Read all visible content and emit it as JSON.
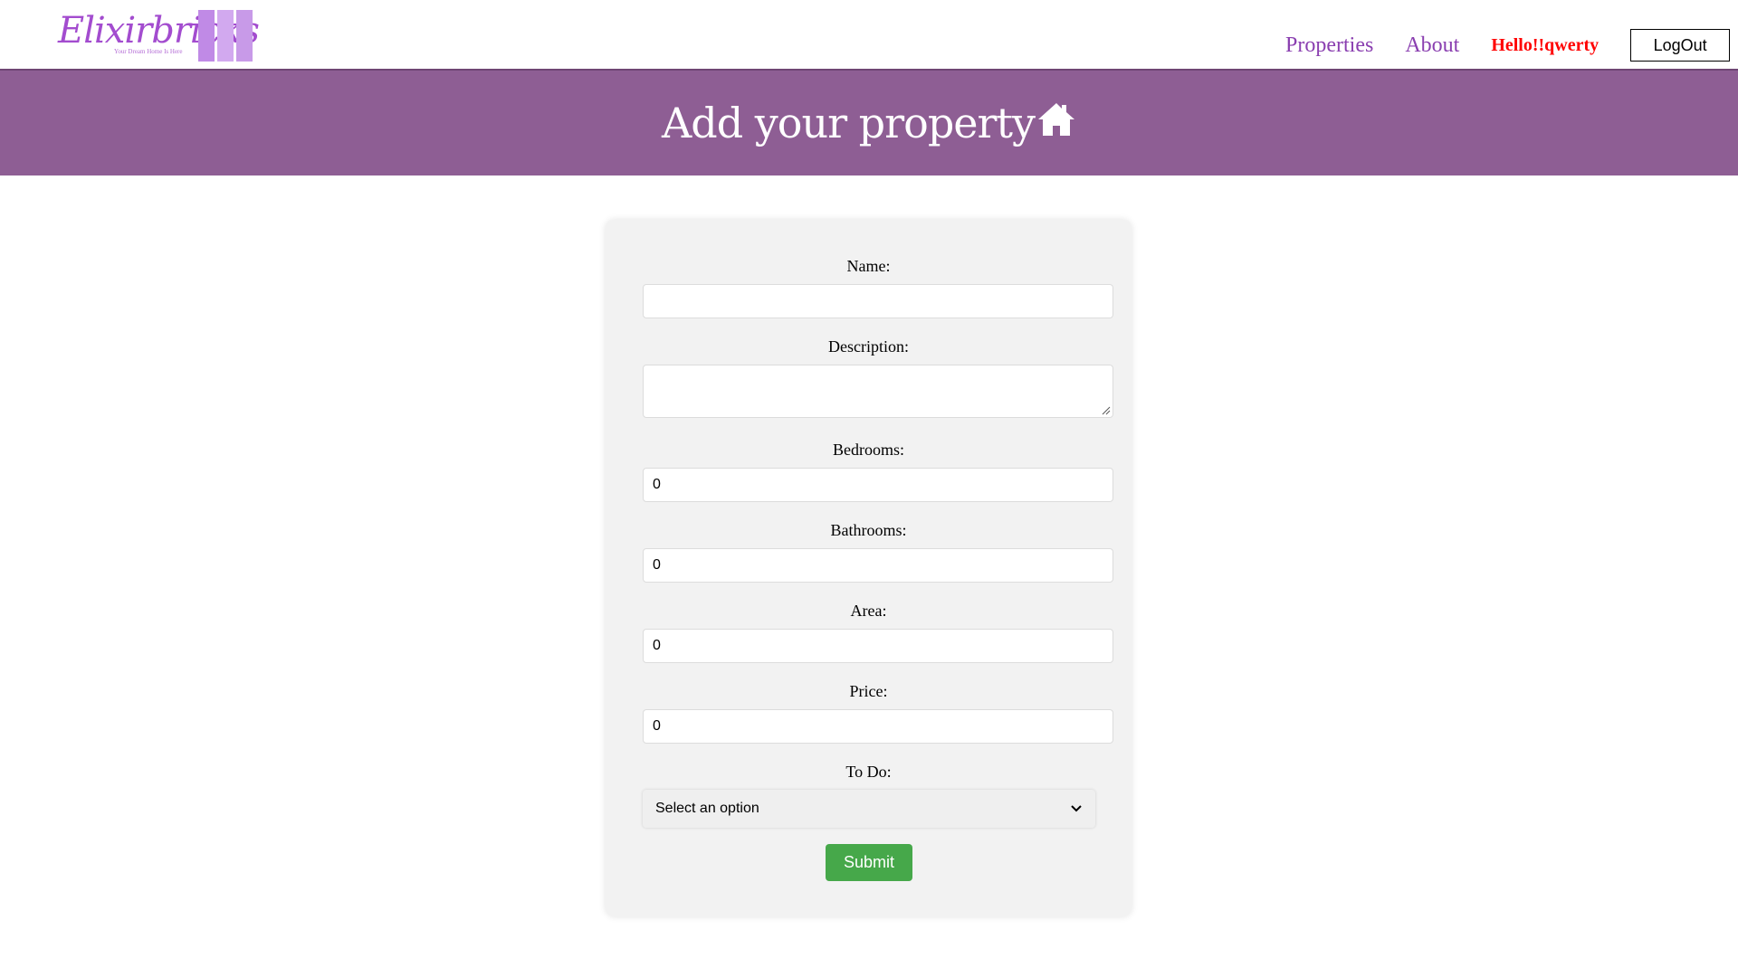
{
  "nav": {
    "logo_text": "Elixirbricks",
    "logo_tagline": "Your Dream Home Is Here",
    "links": [
      "Properties",
      "About"
    ],
    "greeting": "Hello!!qwerty",
    "logout_label": "LogOut"
  },
  "banner": {
    "title": "Add your property",
    "icon": "house-icon"
  },
  "form": {
    "name": {
      "label": "Name:",
      "value": ""
    },
    "description": {
      "label": "Description:",
      "value": ""
    },
    "bedrooms": {
      "label": "Bedrooms:",
      "value": "0"
    },
    "bathrooms": {
      "label": "Bathrooms:",
      "value": "0"
    },
    "area": {
      "label": "Area:",
      "value": "0"
    },
    "price": {
      "label": "Price:",
      "value": "0"
    },
    "todo": {
      "label": "To Do:",
      "selected": "Select an option"
    },
    "submit_label": "Submit"
  },
  "colors": {
    "banner": "#8e5e94",
    "nav_link": "#8a3fb0",
    "greeting": "#ff0000",
    "submit": "#46a84a",
    "card": "#f2f2f2"
  }
}
